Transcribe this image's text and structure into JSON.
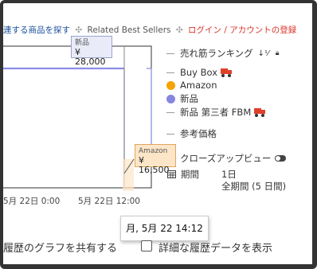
{
  "header_links": {
    "related": "連する商品を探す",
    "best_sellers": "Related Best Sellers",
    "login": "ログイン / アカウントの登録"
  },
  "legend": {
    "sales_rank": "売れ筋ランキング",
    "buy_box": "Buy Box",
    "amazon": "Amazon",
    "new": "新品",
    "new_3p_fbm": "新品 第三者 FBM",
    "ref_price": "参考価格",
    "closeup": "クローズアップビュー",
    "period_label": "期間",
    "period_1d": "1日",
    "period_all": "全期間 (5 日間)"
  },
  "colors": {
    "amazon": "#f4a300",
    "new": "#8686e0",
    "chart_line": "#8b8ee8",
    "accent_red": "#d9342b"
  },
  "tooltips": {
    "new_label": "新品",
    "new_price": "¥ 28,000",
    "amazon_label": "Amazon",
    "amazon_price": "¥ 16,500",
    "date": "月, 5月 22 14:12"
  },
  "chart_data": {
    "type": "line",
    "x_tick_labels": [
      "5月 22日 0:00",
      "5月 22日 12:00"
    ],
    "series": [
      {
        "name": "新品",
        "x": [
          "5月 22日 0:00",
          "5月 22日 14:12"
        ],
        "y": [
          28000,
          28000
        ]
      },
      {
        "name": "Amazon",
        "x": [
          "5月 22日 14:12"
        ],
        "y": [
          16500
        ]
      }
    ]
  },
  "footer": {
    "share": "履歴のグラフを共有する",
    "show_details": "詳細な履歴データを表示"
  }
}
